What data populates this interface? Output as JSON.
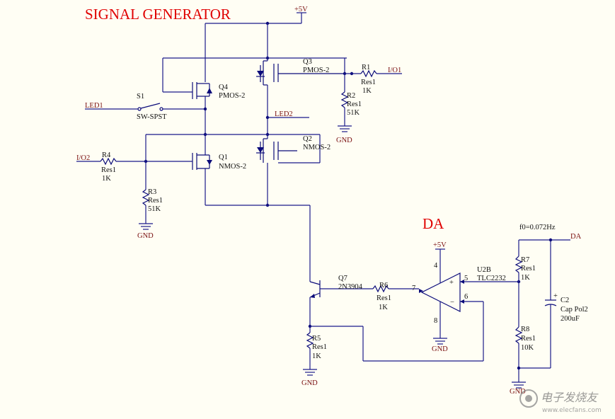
{
  "titles": {
    "signal_generator": "SIGNAL GENERATOR",
    "da": "DA"
  },
  "nets": {
    "vcc_top": "+5V",
    "vcc_amp": "+5V",
    "gnd": "GND",
    "io1": "I/O1",
    "io2": "I/O2",
    "led1": "LED1",
    "led2": "LED2",
    "da_out": "DA",
    "freq_note": "f0=0.072Hz"
  },
  "components": {
    "q3": {
      "ref": "Q3",
      "type": "PMOS-2"
    },
    "q4": {
      "ref": "Q4",
      "type": "PMOS-2"
    },
    "q1": {
      "ref": "Q1",
      "type": "NMOS-2"
    },
    "q2": {
      "ref": "Q2",
      "type": "NMOS-2"
    },
    "q7": {
      "ref": "Q7",
      "type": "2N3904"
    },
    "s1": {
      "ref": "S1",
      "type": "SW-SPST"
    },
    "r1": {
      "ref": "R1",
      "type": "Res1",
      "value": "1K"
    },
    "r2": {
      "ref": "R2",
      "type": "Res1",
      "value": "51K"
    },
    "r3": {
      "ref": "R3",
      "type": "Res1",
      "value": "51K"
    },
    "r4": {
      "ref": "R4",
      "type": "Res1",
      "value": "1K"
    },
    "r5": {
      "ref": "R5",
      "type": "Res1",
      "value": "1K"
    },
    "r6": {
      "ref": "R6",
      "type": "Res1",
      "value": "1K"
    },
    "r7": {
      "ref": "R7",
      "type": "Res1",
      "value": "1K"
    },
    "r8": {
      "ref": "R8",
      "type": "Res1",
      "value": "10K"
    },
    "c2": {
      "ref": "C2",
      "type": "Cap Pol2",
      "value": "200uF"
    },
    "u2b": {
      "ref": "U2B",
      "type": "TLC2232"
    }
  },
  "pins": {
    "u2b_out": "7",
    "u2b_plus": "5",
    "u2b_minus": "6",
    "u2b_vplus": "4",
    "u2b_vminus": "8"
  },
  "op_symbols": {
    "plus": "+",
    "minus": "−"
  },
  "cap_plus": "+",
  "watermark": {
    "text": "电子发烧友",
    "url": "www.elecfans.com"
  }
}
